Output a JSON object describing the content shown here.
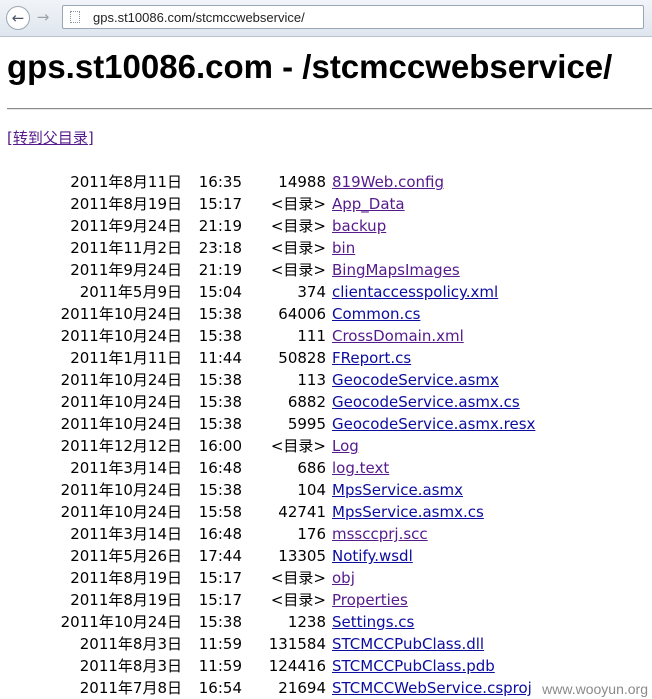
{
  "browser": {
    "back_icon": "arrow-left",
    "forward_icon": "arrow-right",
    "url": "gps.st10086.com/stcmccwebservice/"
  },
  "page": {
    "title": "gps.st10086.com - /stcmccwebservice/",
    "parent_link": "[转到父目录]",
    "watermark": "www.wooyun.org"
  },
  "entries": [
    {
      "date": "2011年8月11日",
      "time": "16:35",
      "size": "14988",
      "name": "819Web.config",
      "visited": true
    },
    {
      "date": "2011年8月19日",
      "time": "15:17",
      "size": "<目录>",
      "name": "App_Data",
      "visited": true
    },
    {
      "date": "2011年9月24日",
      "time": "21:19",
      "size": "<目录>",
      "name": "backup",
      "visited": true
    },
    {
      "date": "2011年11月2日",
      "time": "23:18",
      "size": "<目录>",
      "name": "bin",
      "visited": true
    },
    {
      "date": "2011年9月24日",
      "time": "21:19",
      "size": "<目录>",
      "name": "BingMapsImages",
      "visited": true
    },
    {
      "date": "2011年5月9日",
      "time": "15:04",
      "size": "374",
      "name": "clientaccesspolicy.xml",
      "visited": false
    },
    {
      "date": "2011年10月24日",
      "time": "15:38",
      "size": "64006",
      "name": "Common.cs",
      "visited": false
    },
    {
      "date": "2011年10月24日",
      "time": "15:38",
      "size": "111",
      "name": "CrossDomain.xml",
      "visited": true
    },
    {
      "date": "2011年1月11日",
      "time": "11:44",
      "size": "50828",
      "name": "FReport.cs",
      "visited": false
    },
    {
      "date": "2011年10月24日",
      "time": "15:38",
      "size": "113",
      "name": "GeocodeService.asmx",
      "visited": false
    },
    {
      "date": "2011年10月24日",
      "time": "15:38",
      "size": "6882",
      "name": "GeocodeService.asmx.cs",
      "visited": false
    },
    {
      "date": "2011年10月24日",
      "time": "15:38",
      "size": "5995",
      "name": "GeocodeService.asmx.resx",
      "visited": false
    },
    {
      "date": "2011年12月12日",
      "time": "16:00",
      "size": "<目录>",
      "name": "Log",
      "visited": true
    },
    {
      "date": "2011年3月14日",
      "time": "16:48",
      "size": "686",
      "name": "log.text",
      "visited": true
    },
    {
      "date": "2011年10月24日",
      "time": "15:38",
      "size": "104",
      "name": "MpsService.asmx",
      "visited": false
    },
    {
      "date": "2011年10月24日",
      "time": "15:58",
      "size": "42741",
      "name": "MpsService.asmx.cs",
      "visited": false
    },
    {
      "date": "2011年3月14日",
      "time": "16:48",
      "size": "176",
      "name": "mssccprj.scc",
      "visited": true
    },
    {
      "date": "2011年5月26日",
      "time": "17:44",
      "size": "13305",
      "name": "Notify.wsdl",
      "visited": false
    },
    {
      "date": "2011年8月19日",
      "time": "15:17",
      "size": "<目录>",
      "name": "obj",
      "visited": true
    },
    {
      "date": "2011年8月19日",
      "time": "15:17",
      "size": "<目录>",
      "name": "Properties",
      "visited": true
    },
    {
      "date": "2011年10月24日",
      "time": "15:38",
      "size": "1238",
      "name": "Settings.cs",
      "visited": false
    },
    {
      "date": "2011年8月3日",
      "time": "11:59",
      "size": "131584",
      "name": "STCMCCPubClass.dll",
      "visited": false
    },
    {
      "date": "2011年8月3日",
      "time": "11:59",
      "size": "124416",
      "name": "STCMCCPubClass.pdb",
      "visited": false
    },
    {
      "date": "2011年7月8日",
      "time": "16:54",
      "size": "21694",
      "name": "STCMCCWebService.csproj",
      "visited": false
    }
  ]
}
